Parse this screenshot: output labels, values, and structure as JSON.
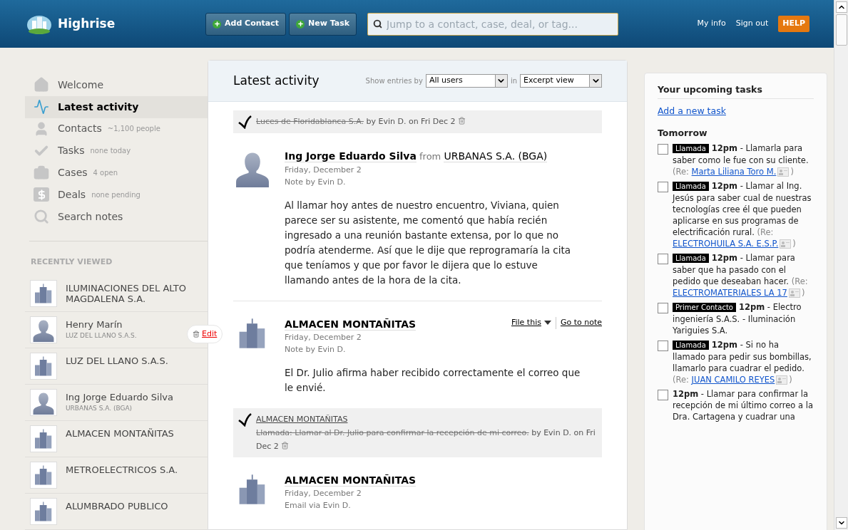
{
  "header": {
    "app_name": "Highrise",
    "buttons": [
      {
        "label": "Add Contact"
      },
      {
        "label": "New Task"
      }
    ],
    "search": {
      "placeholder": "Jump to a contact, case, deal, or tag..."
    },
    "links": [
      "My info",
      "Sign out"
    ],
    "help": "HELP"
  },
  "sidebar": {
    "nav": [
      {
        "kind": "home",
        "label": "Welcome",
        "selected": false
      },
      {
        "kind": "activity",
        "label": "Latest activity",
        "selected": true
      },
      {
        "kind": "person",
        "label": "Contacts",
        "count": "~1,100 people",
        "selected": false
      },
      {
        "kind": "check",
        "label": "Tasks",
        "count": "none today",
        "selected": false
      },
      {
        "kind": "case",
        "label": "Cases",
        "count": "4 open",
        "selected": false
      },
      {
        "kind": "deal",
        "label": "Deals",
        "count": "none pending",
        "selected": false
      },
      {
        "kind": "search",
        "label": "Search notes",
        "selected": false
      }
    ],
    "recent_title": "RECENTLY VIEWED",
    "recent": [
      {
        "kind": "company",
        "name": "ILUMINACIONES DEL ALTO MAGDALENA S.A."
      },
      {
        "kind": "person",
        "name": "Henry Marín",
        "sub": "LUZ DEL LLANO S.A.S."
      },
      {
        "kind": "company",
        "name": "LUZ DEL LLANO S.A.S."
      },
      {
        "kind": "person",
        "name": "Ing Jorge Eduardo Silva",
        "sub": "URBANAS S.A. (BGA)"
      },
      {
        "kind": "company",
        "name": "ALMACEN MONTAÑITAS"
      },
      {
        "kind": "company",
        "name": "METROELECTRICOS S.A."
      },
      {
        "kind": "company",
        "name": "ALUMBRADO PUBLICO"
      }
    ],
    "edit_label": "Edit"
  },
  "activity": {
    "title": "Latest activity",
    "filter_label": "Show entries by",
    "user_select": "All users",
    "in_label": "in",
    "view_select": "Excerpt view",
    "items": [
      {
        "kind": "done",
        "task": "Luces de Floridablanca S.A.",
        "by": "by Evin D. on Fri Dec 2"
      },
      {
        "kind": "note",
        "avatar": {
          "kind": "person"
        },
        "name": "Ing Jorge Eduardo Silva",
        "from": "from",
        "company": "URBANAS S.A. (BGA)",
        "date": "Friday, December 2",
        "author": "Note by Evin D.",
        "body": "Al llamar hoy antes de nuestro encuentro, Viviana, quien parece ser su asistente, me comentó que había recién ingresado a una reunión bastante extensa, por lo que no podría atenderme. Así que le dije que reprogramaría la cita que teníamos y que por favor le dijera que lo estuve llamando antes de la hora de la cita."
      },
      {
        "kind": "note",
        "avatar": {
          "kind": "company"
        },
        "name": "ALMACEN MONTAÑITAS",
        "actions": [
          "File this",
          "Go to note"
        ],
        "date": "Friday, December 2",
        "author": "Note by Evin D.",
        "body": "El Dr. Julio afirma haber recibido correctamente el correo que le envié."
      },
      {
        "kind": "done",
        "subject": "ALMACEN MONTAÑITAS",
        "task": "Llamada: Llamar al Dr. Julio para confirmar la recepción de mi correo.",
        "by": "by Evin D. on Fri Dec 2"
      },
      {
        "kind": "note",
        "avatar": {
          "kind": "company"
        },
        "name": "ALMACEN MONTAÑITAS",
        "date": "Friday, December 2",
        "author": "Email via Evin D."
      }
    ]
  },
  "tasks": {
    "title": "Your upcoming tasks",
    "add_link": "Add a new task",
    "group": "Tomorrow",
    "items": [
      {
        "checked": false,
        "category": "Llamada",
        "text": "**12pm** - Llamarla para saber como le fue con su cliente.",
        "re_open": "(Re:",
        "re_name": "Marta Liliana Toro M.",
        "re_close": ")"
      },
      {
        "checked": false,
        "category": "Llamada",
        "text": "**12pm** - Llamar al Ing. Jesús para saber cual de nuestras tecnologías cree él que pueden aplicarse en sus programas de electrificación rural.",
        "re_open": "(Re:",
        "re_name": "ELECTROHUILA S.A. E.S.P.",
        "re_close": ")"
      },
      {
        "checked": false,
        "category": "Llamada",
        "text": "**12pm** - Llamar para saber que ha pasado con el pedido que deseaban hacer.",
        "re_open": "(Re:",
        "re_name": "ELECTROMATERIALES LA 17",
        "re_close": ")"
      },
      {
        "checked": false,
        "category": "Primer Contacto",
        "text": "**12pm** - Electro ingeniería S.A.S. - Iluminación Yariguies S.A."
      },
      {
        "checked": false,
        "category": "Llamada",
        "text": "**12pm** - Si no ha llamado para pedir sus bombillas, llamarlo para cuadrar el pedido.",
        "re_open": "(Re:",
        "re_name": "JUAN CAMILO REYES",
        "re_close": ")"
      },
      {
        "checked": false,
        "text": "**12pm** - Llamar para confirmar la recepción de mi último correo a la Dra. Cartagena y cuadrar una"
      }
    ]
  }
}
